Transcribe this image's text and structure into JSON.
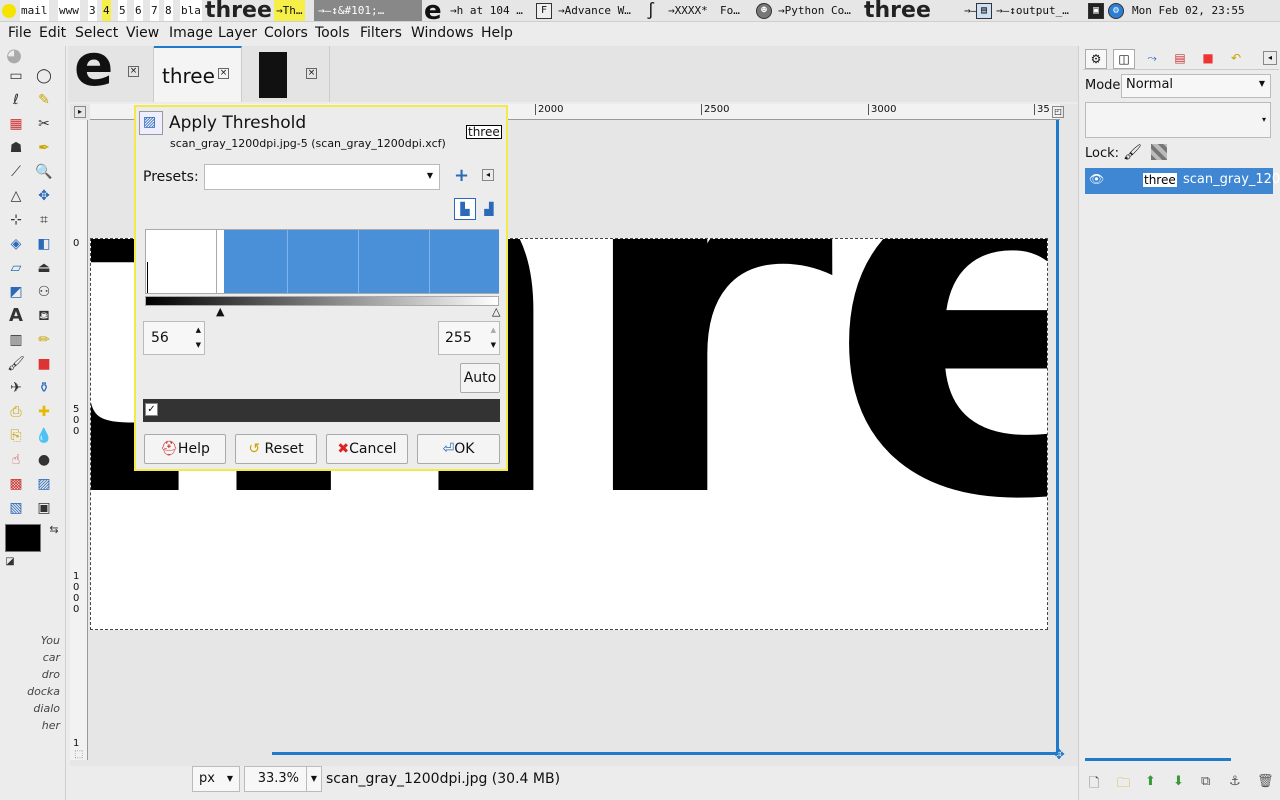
{
  "taskbar": {
    "workspaces": [
      "mail",
      "www",
      "3",
      "4",
      "5",
      "6",
      "7",
      "8",
      "bla"
    ],
    "current_workspace": "4",
    "items": [
      {
        "label": "three",
        "big": true
      },
      {
        "label": "→Th…"
      },
      {
        "label": "→–↕&#101;…"
      },
      {
        "label": "e",
        "big": true
      },
      {
        "label": "→h at 104 …"
      },
      {
        "label": "→Advance W…"
      },
      {
        "label": "→XXXX*"
      },
      {
        "label": "Fo…"
      },
      {
        "label": "→Python Co…"
      },
      {
        "label": "three",
        "big": true
      },
      {
        "label": "→–↕…"
      },
      {
        "label": "→–↕output_…"
      }
    ],
    "clock": "Mon Feb 02, 23:55"
  },
  "menubar": [
    "File",
    "Edit",
    "Select",
    "View",
    "Image",
    "Layer",
    "Colors",
    "Tools",
    "Filters",
    "Windows",
    "Help"
  ],
  "toolbox": {
    "hint": [
      "You",
      "car",
      "dro",
      "docka",
      "dialo",
      "her"
    ]
  },
  "image_tabs": [
    {
      "label": "e"
    },
    {
      "label": "three"
    },
    {
      "label": ""
    }
  ],
  "ruler": {
    "h_ticks": [
      "2000",
      "2500",
      "3000",
      "35"
    ],
    "v_ticks": [
      "0",
      "5\n0\n0",
      "1\n0\n0\n0",
      "1"
    ]
  },
  "canvas": {
    "word": "three"
  },
  "dialog": {
    "title": "Apply Threshold",
    "subtitle": "scan_gray_1200dpi.jpg-5 (scan_gray_1200dpi.xcf)",
    "thumb_label": "three",
    "presets_label": "Presets:",
    "presets_value": "",
    "low_value": "56",
    "high_value": "255",
    "auto_label": "Auto",
    "preview_checked": true,
    "buttons": {
      "help": "Help",
      "reset": "Reset",
      "cancel": "Cancel",
      "ok": "OK"
    }
  },
  "status": {
    "unit": "px",
    "zoom": "33.3",
    "zoom_unit": "%",
    "file_info": "scan_gray_1200dpi.jpg (30.4 MB)"
  },
  "layers_dock": {
    "mode_label": "Mode:",
    "mode_value": "Normal",
    "lock_label": "Lock:",
    "layer_thumb_label": "three",
    "layer_name": "scan_gray_120"
  },
  "colors": {
    "accent": "#1f7ac9",
    "selected_row": "#3f86d3",
    "dialog_border": "#f2e94a",
    "histogram": "#4a90d9"
  }
}
